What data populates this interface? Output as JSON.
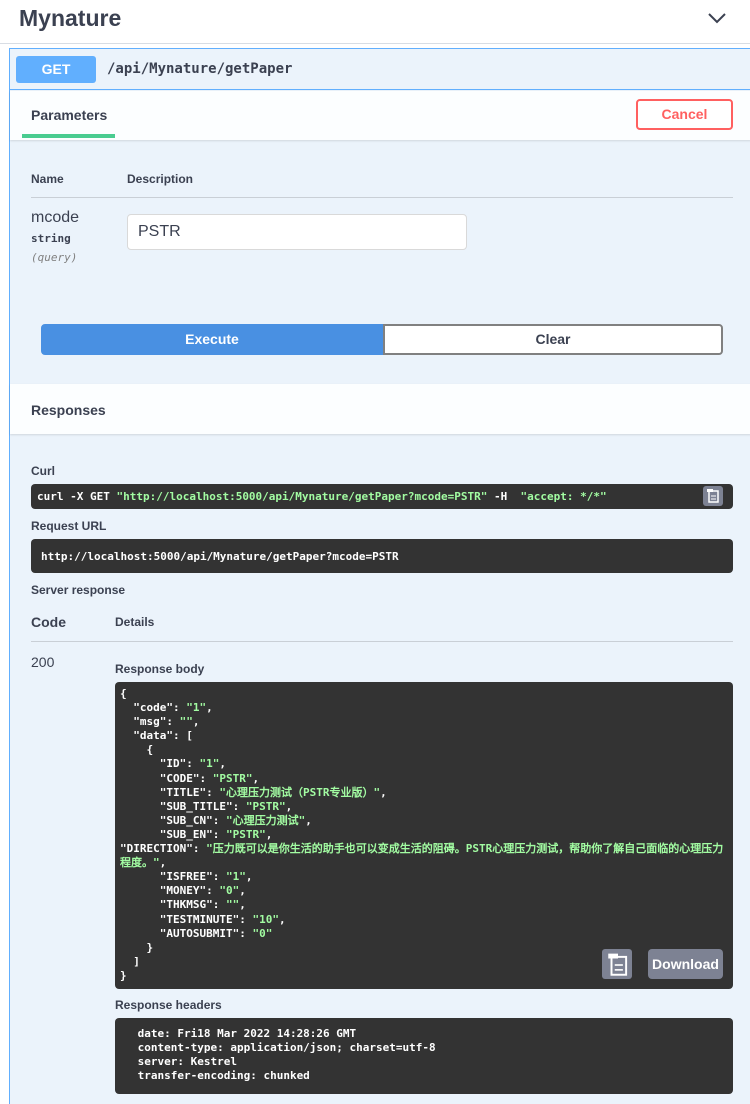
{
  "tag": {
    "title": "Mynature",
    "toggle_icon": "chevron-down-icon"
  },
  "operation": {
    "method": "GET",
    "path": "/api/Mynature/getPaper"
  },
  "parameters": {
    "tab_label": "Parameters",
    "cancel_label": "Cancel",
    "col_name": "Name",
    "col_description": "Description",
    "items": [
      {
        "name": "mcode",
        "type": "string",
        "in": "(query)",
        "value": "PSTR"
      }
    ]
  },
  "actions": {
    "execute_label": "Execute",
    "clear_label": "Clear"
  },
  "responses": {
    "title": "Responses",
    "curl_label": "Curl",
    "curl": {
      "prefix": "curl -X GET ",
      "url": "\"http://localhost:5000/api/Mynature/getPaper?mcode=PSTR\"",
      "mid": " -H  ",
      "header": "\"accept: */*\""
    },
    "request_url_label": "Request URL",
    "request_url": "http://localhost:5000/api/Mynature/getPaper?mcode=PSTR",
    "server_response_label": "Server response",
    "col_code": "Code",
    "col_details": "Details",
    "code": "200",
    "body_label": "Response body",
    "body": {
      "code": "\"1\"",
      "msg": "\"\"",
      "data": [
        {
          "ID": "\"1\"",
          "CODE": "\"PSTR\"",
          "TITLE": "\"心理压力测试（PSTR专业版）\"",
          "SUB_TITLE": "\"PSTR\"",
          "SUB_CN": "\"心理压力测试\"",
          "SUB_EN": "\"PSTR\"",
          "DIRECTION": "\"压力既可以是你生活的助手也可以变成生活的阻碍。PSTR心理压力测试，帮助你了解自己面临的心理压力程度。\"",
          "ISFREE": "\"1\"",
          "MONEY": "\"0\"",
          "THKMSG": "\"\"",
          "TESTMINUTE": "\"10\"",
          "AUTOSUBMIT": "\"0\""
        }
      ]
    },
    "download_label": "Download",
    "headers_label": "Response headers",
    "headers": [
      " date: Fri18 Mar 2022 14:28:26 GMT ",
      " content-type: application/json; charset=utf-8 ",
      " server: Kestrel ",
      " transfer-encoding: chunked "
    ]
  },
  "colors": {
    "get_blue": "#61affe",
    "execute_blue": "#4990e2",
    "cancel_red": "#ff6060",
    "tab_green": "#49cc90",
    "code_bg": "#333333",
    "string_green": "#a2fca2"
  }
}
